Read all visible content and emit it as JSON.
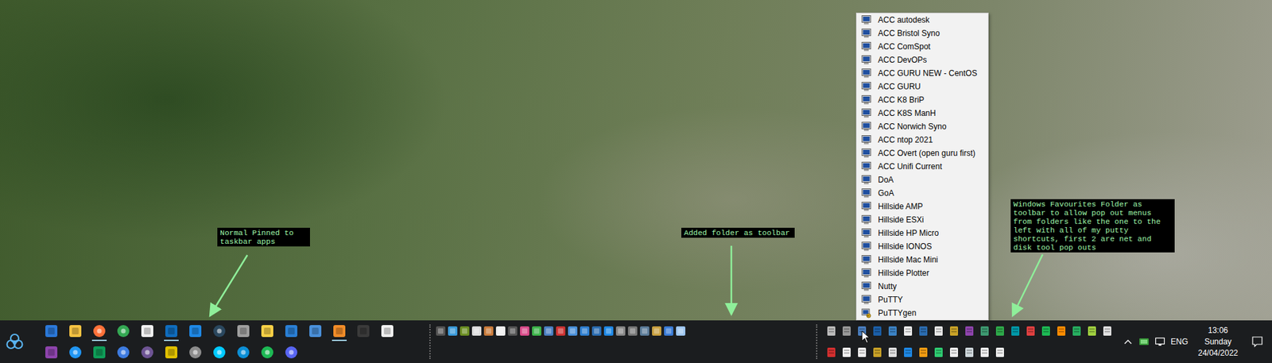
{
  "desktop": {
    "wallpaper": "photo"
  },
  "annotations": [
    {
      "lines": [
        "Normal Pinned to",
        "taskbar apps"
      ]
    },
    {
      "lines": [
        "Added folder as toolbar"
      ]
    },
    {
      "lines": [
        "Windows Favourites Folder as",
        "toolbar to allow pop out menus",
        "from folders like the one to the",
        "left with all of my putty",
        "shortcuts, first 2 are net and",
        "disk tool pop outs"
      ]
    }
  ],
  "popup_menu": {
    "items": [
      {
        "label": "ACC autodesk",
        "kind": "putty"
      },
      {
        "label": "ACC Bristol Syno",
        "kind": "putty"
      },
      {
        "label": "ACC ComSpot",
        "kind": "putty"
      },
      {
        "label": "ACC DevOPs",
        "kind": "putty"
      },
      {
        "label": "ACC GURU NEW - CentOS",
        "kind": "putty"
      },
      {
        "label": "ACC GURU",
        "kind": "putty"
      },
      {
        "label": "ACC K8 BriP",
        "kind": "putty"
      },
      {
        "label": "ACC K8S ManH",
        "kind": "putty"
      },
      {
        "label": "ACC Norwich Syno",
        "kind": "putty"
      },
      {
        "label": "ACC ntop 2021",
        "kind": "putty"
      },
      {
        "label": "ACC Overt (open guru first)",
        "kind": "putty"
      },
      {
        "label": "ACC Unifi Current",
        "kind": "putty"
      },
      {
        "label": "DoA",
        "kind": "putty"
      },
      {
        "label": "GoA",
        "kind": "putty"
      },
      {
        "label": "Hillside AMP",
        "kind": "putty"
      },
      {
        "label": "Hillside ESXi",
        "kind": "putty"
      },
      {
        "label": "Hillside HP Micro",
        "kind": "putty"
      },
      {
        "label": "Hillside IONOS",
        "kind": "putty"
      },
      {
        "label": "Hillside Mac Mini",
        "kind": "putty"
      },
      {
        "label": "Hillside Plotter",
        "kind": "putty"
      },
      {
        "label": "Nutty",
        "kind": "putty"
      },
      {
        "label": "PuTTY",
        "kind": "putty"
      },
      {
        "label": "PuTTYgen",
        "kind": "keygen"
      }
    ]
  },
  "taskbar": {
    "pinned_apps": [
      [
        {
          "running": false
        },
        {
          "running": false
        },
        {
          "running": true
        },
        {
          "running": false
        },
        {
          "running": false
        },
        {
          "running": true
        },
        {
          "running": false
        },
        {
          "running": false
        },
        {
          "running": false
        },
        {
          "running": false
        },
        {
          "running": false
        },
        {
          "running": false
        },
        {
          "running": true
        },
        {
          "running": false
        },
        {
          "running": false
        }
      ],
      [
        {
          "running": false
        },
        {
          "running": false
        },
        {
          "running": false
        },
        {
          "running": false
        },
        {
          "running": false
        },
        {
          "running": false
        },
        {
          "running": false
        },
        {
          "running": false
        },
        {
          "running": false
        },
        {
          "running": false
        },
        {
          "running": false
        }
      ]
    ],
    "tray": {
      "language": "ENG",
      "time": "13:06",
      "day": "Sunday",
      "date": "24/04/2022"
    }
  }
}
